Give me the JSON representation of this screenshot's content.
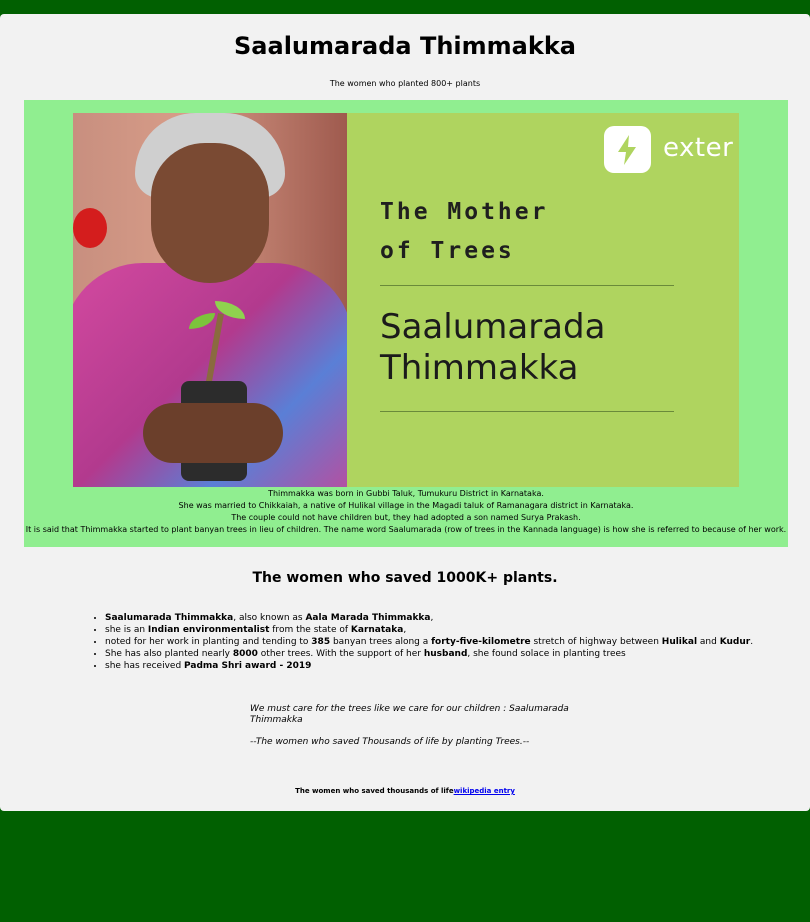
{
  "page": {
    "title": "Saalumarada Thimmakka",
    "subtitle": "The women who planted 800+ plants"
  },
  "banner": {
    "logo_text": "exter",
    "heading_line1": "The Mother",
    "heading_line2": "of Trees",
    "name_line1": "Saalumarada",
    "name_line2": "Thimmakka"
  },
  "caption": [
    "Thimmakka was born in Gubbi Taluk, Tumukuru District in Karnataka.",
    "She was married to Chikkaiah, a native of Hulikal village in the Magadi taluk of Ramanagara district in Karnataka.",
    "The couple could not have children but, they had adopted a son named Surya Prakash.",
    "It is said that Thimmakka started to plant banyan trees in lieu of children. The name word Saalumarada (row of trees in the Kannada language) is how she is referred to because of her work."
  ],
  "section": {
    "heading": "The women who saved 1000K+ plants."
  },
  "facts": {
    "f1_b1": "Saalumarada Thimmakka",
    "f1_t1": ", also known as ",
    "f1_b2": "Aala Marada Thimmakka",
    "f1_t2": ",",
    "f2_t1": "she is an ",
    "f2_b1": "Indian environmentalist",
    "f2_t2": " from the state of ",
    "f2_b2": "Karnataka",
    "f2_t3": ",",
    "f3_t1": "noted for her work in planting and tending to ",
    "f3_b1": "385",
    "f3_t2": " banyan trees along a ",
    "f3_b2": "forty-five-kilometre",
    "f3_t3": " stretch of highway between ",
    "f3_b3": "Hulikal",
    "f3_t4": " and ",
    "f3_b4": "Kudur",
    "f3_t5": ".",
    "f4_t1": "She has also planted nearly ",
    "f4_b1": "8000",
    "f4_t2": " other trees. With the support of her ",
    "f4_b2": "husband",
    "f4_t3": ", she found solace in planting trees",
    "f5_t1": "she has received ",
    "f5_b1": "Padma Shri award - 2019"
  },
  "quote": {
    "text": "We must care for the trees like we care for our children : Saalumarada Thimmakka",
    "attribution": "--The women who saved Thousands of life by planting Trees.--"
  },
  "footer": {
    "text": "The women who saved thousands of life",
    "link_label": "wikipedia entry"
  }
}
